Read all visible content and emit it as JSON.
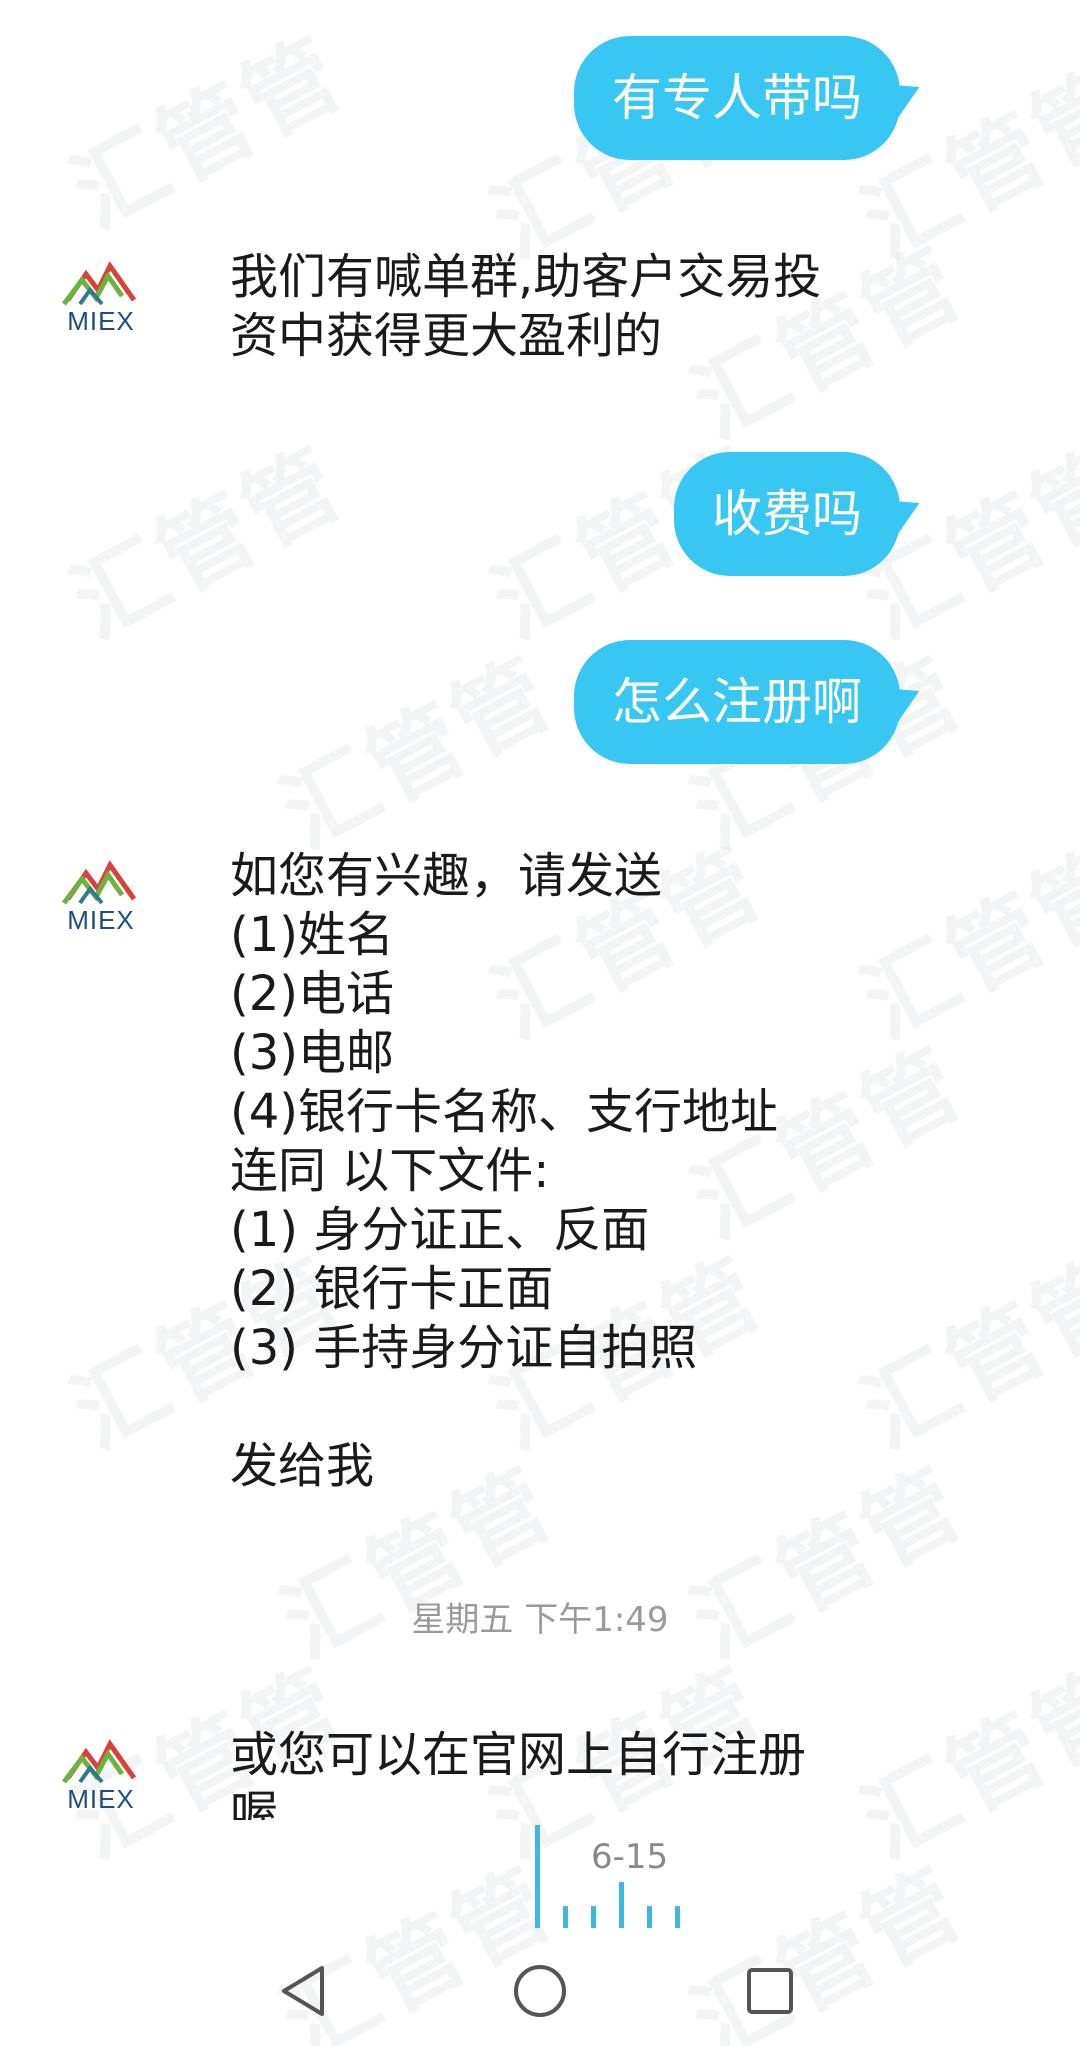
{
  "watermark": {
    "text": "汇管管"
  },
  "colors": {
    "bubble_out": "#38c6f2",
    "text_in": "#1a1a1a",
    "timestamp": "#9a9a9a",
    "indicator": "#3bb9e0"
  },
  "messages": {
    "out_1": "有专人带吗",
    "in_1": {
      "sender": "MIEX",
      "lines": [
        "我们有喊单群,助客户交易投",
        "资中获得更大盈利的"
      ]
    },
    "out_2": "收费吗",
    "out_3": "怎么注册啊",
    "in_2": {
      "sender": "MIEX",
      "lines": [
        "如您有兴趣，请发送",
        "(1)姓名",
        "(2)电话",
        "(3)电邮",
        "(4)银行卡名称、支行地址",
        "连同 以下文件:",
        "(1) 身分证正、反面",
        "(2) 银行卡正面",
        "(3) 手持身分证自拍照",
        "",
        "发给我"
      ]
    },
    "timestamp": "星期五 下午1:49",
    "in_3": {
      "sender": "MIEX",
      "lines": [
        "或您可以在官网上自行注册",
        "喔"
      ]
    }
  },
  "scroll_indicator": {
    "label": "6-15"
  },
  "nav": {
    "back_icon": "back-triangle-icon",
    "home_icon": "home-circle-icon",
    "recents_icon": "recents-square-icon"
  }
}
